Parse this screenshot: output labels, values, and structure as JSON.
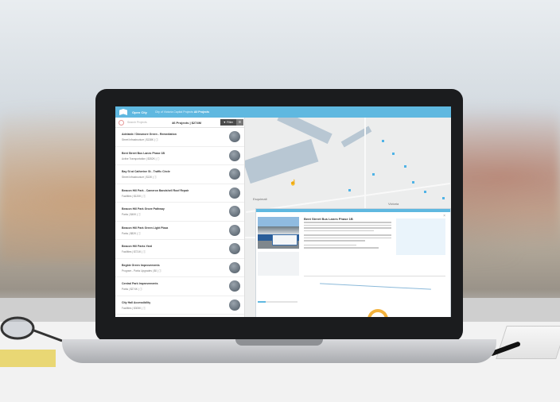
{
  "app": {
    "brand": "Open City",
    "breadcrumb_prefix": "City of Victoria Capital Projects",
    "breadcrumb_current": "All Projects",
    "accent_color": "#5fb8e0"
  },
  "sidebar": {
    "search_placeholder": "Search Projects",
    "summary": "46 Projects | $274M",
    "filter_label": "▼ Filter",
    "list_toggle_label": "☰",
    "projects": [
      {
        "name": "Adelaide / Dinsmore Green - Remediation",
        "meta": "Street Infrastructure | $138K | ⓘ"
      },
      {
        "name": "Bent Street Bus Lanes Phase 1B",
        "meta": "Active Transportation | $352K | ⓘ"
      },
      {
        "name": "Bay St at Catherine St - Traffic Circle",
        "meta": "Street Infrastructure | $13K | ⓘ"
      },
      {
        "name": "Beacon Hill Park - Cameron Bandshell Roof Repair",
        "meta": "Facilities | $120K | ⓘ"
      },
      {
        "name": "Beacon Hill Park Grove Pathway",
        "meta": "Parks | $40K | ⓘ"
      },
      {
        "name": "Beacon Hill Park Green Light Plaza",
        "meta": "Parks | $82K | ⓘ"
      },
      {
        "name": "Beacon Hill Parks Yard",
        "meta": "Facilities | $721K | ⓘ"
      },
      {
        "name": "Begbie Green Improvements",
        "meta": "Program - Parks Upgrades | $0 | ⓘ"
      },
      {
        "name": "Central Park Improvements",
        "meta": "Parks | $274K | ⓘ"
      },
      {
        "name": "City Hall Accessibility",
        "meta": "Facilities | $305K | ⓘ"
      }
    ]
  },
  "map": {
    "labels": [
      "Esquimalt",
      "Victoria"
    ]
  },
  "panel": {
    "title": "Bent Street Bus Lanes Phase 1B",
    "close": "×"
  }
}
